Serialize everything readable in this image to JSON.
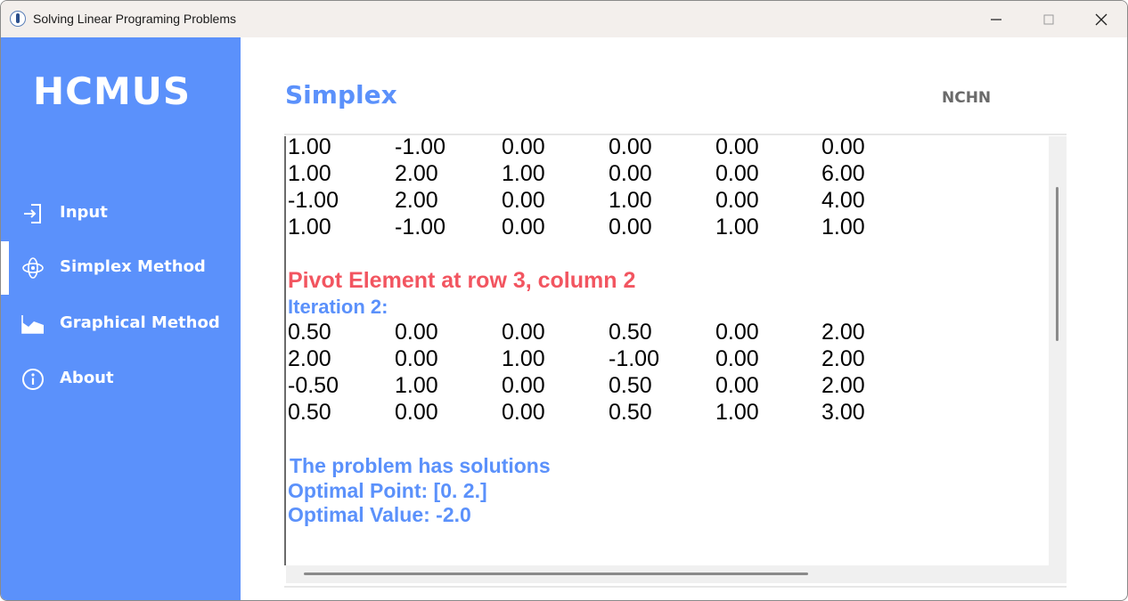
{
  "window": {
    "title": "Solving Linear Programing Problems"
  },
  "sidebar": {
    "brand": "HCMUS",
    "items": [
      {
        "label": "Input",
        "icon": "login-icon"
      },
      {
        "label": "Simplex Method",
        "icon": "atom-icon",
        "active": true
      },
      {
        "label": "Graphical Method",
        "icon": "area-chart-icon"
      },
      {
        "label": "About",
        "icon": "info-icon"
      }
    ],
    "color": "#5b91fb"
  },
  "main": {
    "title": "Simplex",
    "user": "NCHN"
  },
  "output": {
    "table1": [
      [
        "1.00",
        "-1.00",
        "0.00",
        "0.00",
        "0.00",
        "0.00"
      ],
      [
        "1.00",
        "2.00",
        "1.00",
        "0.00",
        "0.00",
        "6.00"
      ],
      [
        "-1.00",
        "2.00",
        "0.00",
        "1.00",
        "0.00",
        "4.00"
      ],
      [
        "1.00",
        "-1.00",
        "0.00",
        "0.00",
        "1.00",
        "1.00"
      ]
    ],
    "pivot": "Pivot Element at row 3, column 2",
    "iteration": "Iteration 2:",
    "table2": [
      [
        "0.50",
        "0.00",
        "0.00",
        "0.50",
        "0.00",
        "2.00"
      ],
      [
        "2.00",
        "0.00",
        "1.00",
        "-1.00",
        "0.00",
        "2.00"
      ],
      [
        "-0.50",
        "1.00",
        "0.00",
        "0.50",
        "0.00",
        "2.00"
      ],
      [
        "0.50",
        "0.00",
        "0.00",
        "0.50",
        "1.00",
        "3.00"
      ]
    ],
    "status": "The problem has solutions",
    "optimal_point": "Optimal Point: [0. 2.]",
    "optimal_value": "Optimal Value: -2.0",
    "colors": {
      "pivot": "#f25560",
      "info": "#5b91fb"
    }
  }
}
